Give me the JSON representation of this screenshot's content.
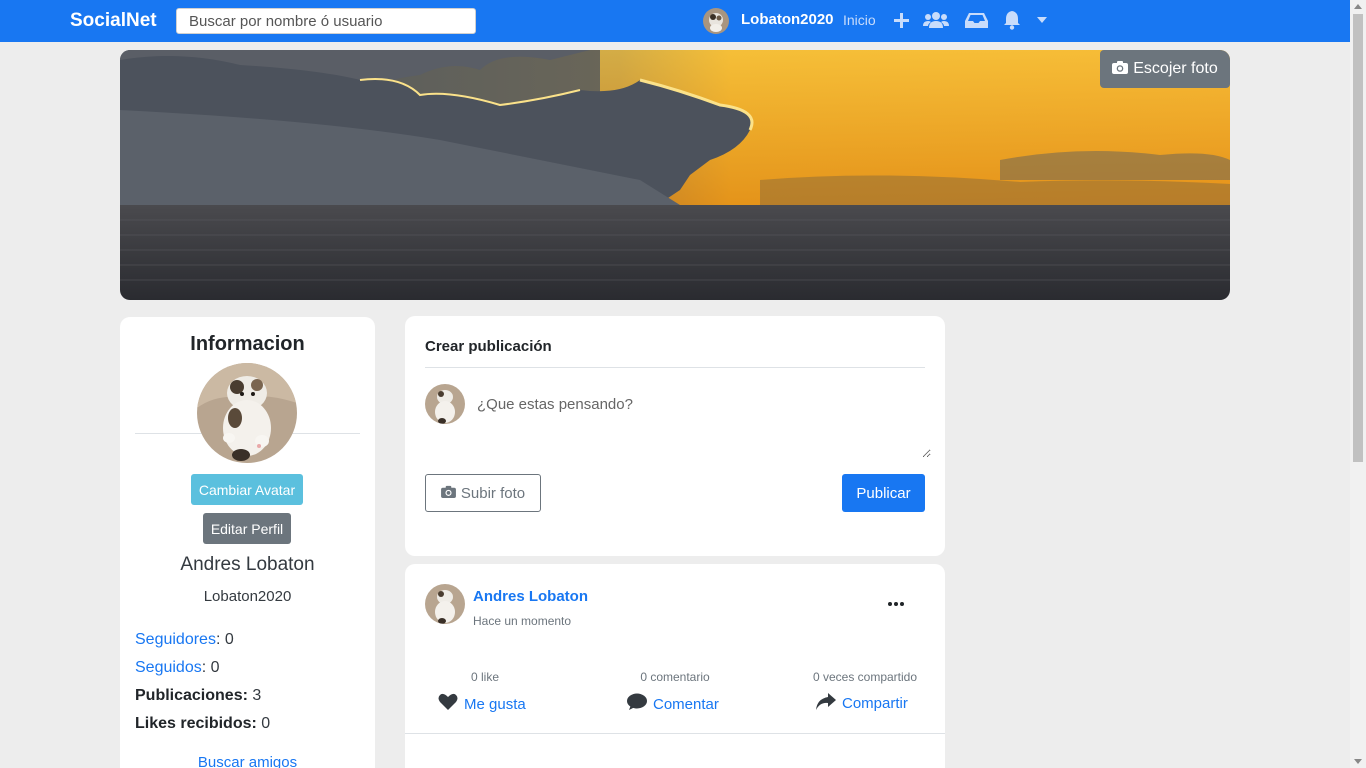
{
  "nav": {
    "brand": "SocialNet",
    "search_placeholder": "Buscar por nombre ó usuario",
    "username": "Lobaton2020",
    "home": "Inicio",
    "icons": [
      "plus-icon",
      "users-icon",
      "inbox-icon",
      "bell-icon",
      "caret-down-icon"
    ]
  },
  "cover": {
    "choose_photo": "Escojer foto"
  },
  "profile": {
    "title": "Informacion",
    "change_avatar": "Cambiar Avatar",
    "edit_profile": "Editar Perfil",
    "full_name": "Andres Lobaton",
    "username": "Lobaton2020",
    "stats": [
      {
        "label": "Seguidores",
        "value": ": 0"
      },
      {
        "label": "Seguidos",
        "value": ": 0"
      },
      {
        "label": "Publicaciones:",
        "value": " 3"
      },
      {
        "label": "Likes recibidos:",
        "value": " 0"
      }
    ],
    "find_friends": "Buscar amigos"
  },
  "create_post": {
    "title": "Crear publicación",
    "placeholder": "¿Que estas pensando?",
    "upload_photo": "Subir foto",
    "publish": "Publicar"
  },
  "post": {
    "author": "Andres Lobaton",
    "time": "Hace un momento",
    "likes": "0 like",
    "comments": "0 comentario",
    "shares": "0 veces compartido",
    "like_action": "Me gusta",
    "comment_action": "Comentar",
    "share_action": "Compartir"
  },
  "colors": {
    "primary": "#1877f2",
    "info": "#5bc0de",
    "secondary": "#6c757d",
    "background": "#ededed"
  }
}
